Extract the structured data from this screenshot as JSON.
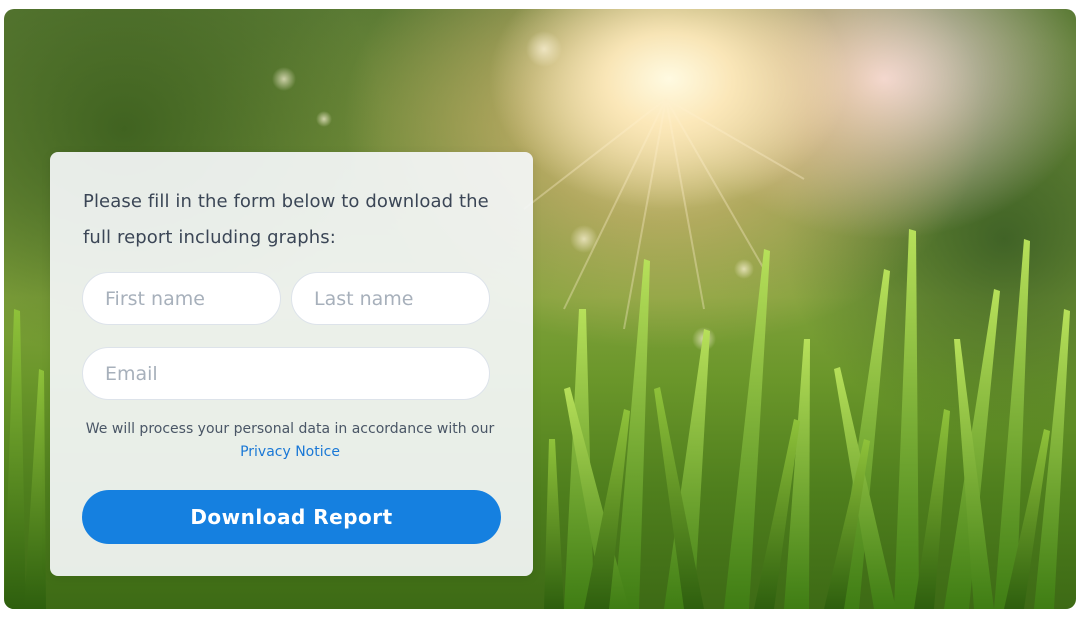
{
  "form": {
    "headline": "Please fill in the form below to download the full report including graphs:",
    "first_name_placeholder": "First name",
    "last_name_placeholder": "Last name",
    "email_placeholder": "Email",
    "notice_text": "We will process your personal data in accordance with our",
    "privacy_link": "Privacy Notice",
    "submit_label": "Download Report"
  },
  "colors": {
    "accent": "#1580e0",
    "link": "#1a78d6",
    "text": "#3b4656",
    "card_background": "#f4f6f8"
  }
}
